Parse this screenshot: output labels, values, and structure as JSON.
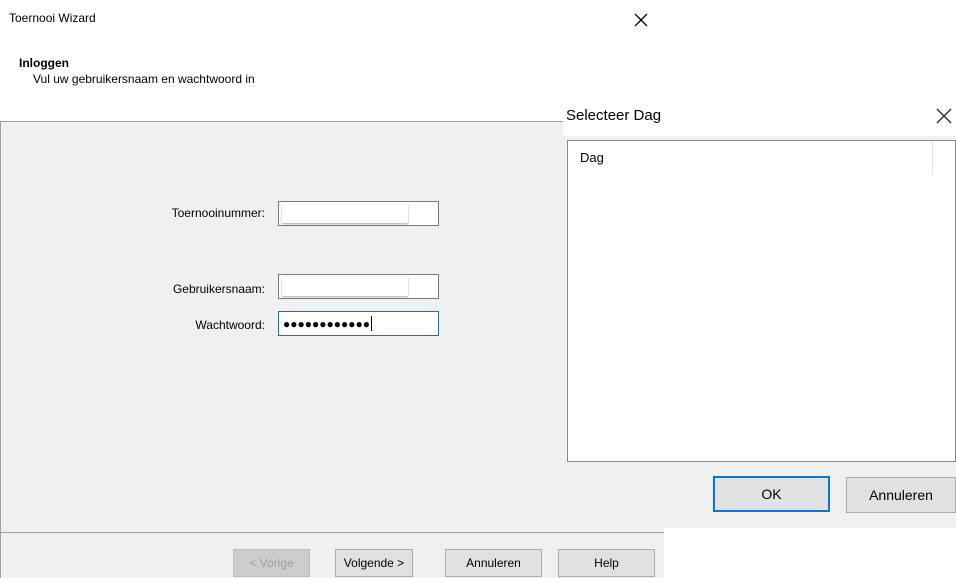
{
  "wizard": {
    "title": "Toernooi Wizard",
    "heading": "Inloggen",
    "subheading": "Vul uw gebruikersnaam en wachtwoord in",
    "fields": {
      "tournament_label": "Toernooinummer:",
      "username_label": "Gebruikersnaam:",
      "password_label": "Wachtwoord:",
      "password_value": "●●●●●●●●●●●●"
    },
    "buttons": {
      "previous": "< Vorige",
      "next": "Volgende >",
      "cancel": "Annuleren",
      "help": "Help"
    }
  },
  "dialog": {
    "title": "Selecteer Dag",
    "column_header": "Dag",
    "buttons": {
      "ok": "OK",
      "cancel": "Annuleren"
    }
  },
  "icons": {
    "wizard_close": "close-icon",
    "dialog_close": "close-icon"
  },
  "colors": {
    "focus_border": "#0078d7",
    "window_bg": "#f0f0f0",
    "disabled_text": "#a0a0a0"
  }
}
